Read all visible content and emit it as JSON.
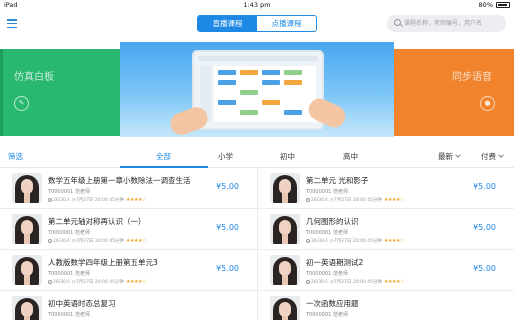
{
  "status_bar": {
    "device": "iPad",
    "time": "1:43 pm",
    "battery": "80%"
  },
  "header": {
    "tabs": [
      {
        "label": "直播课程",
        "active": true
      },
      {
        "label": "点播课程",
        "active": false
      }
    ],
    "search_placeholder": "课程名称，老师编号，用户名"
  },
  "banner": {
    "left_label": "仿真白板",
    "right_label": "同步语音",
    "left_icon": "pen-icon",
    "right_icon": "mic-icon",
    "dots": 4,
    "active_dot": 0
  },
  "filter": {
    "left": "筛选",
    "grades": [
      "全部",
      "小学",
      "初中",
      "高中"
    ],
    "active_grade": "全部",
    "sort": "最新",
    "price": "付费"
  },
  "courses": [
    {
      "title": "数学五年级上册第一章小数除法一调查生活",
      "teacher": "T0000001 范老师",
      "enrolled": "26/30人",
      "date": "7月27日 20:00",
      "duration": "45分钟",
      "stars": "★★★★☆",
      "price": "¥5.00"
    },
    {
      "title": "第二单元 光和影子",
      "teacher": "T0000001 范老师",
      "enrolled": "26/30人",
      "date": "7月27日 20:00",
      "duration": "45分钟",
      "stars": "★★★★☆",
      "price": "¥5.00"
    },
    {
      "title": "第二单元轴对称再认识（一）",
      "teacher": "T0000001 范老师",
      "enrolled": "26/30人",
      "date": "7月27日 20:00",
      "duration": "45分钟",
      "stars": "★★★★☆",
      "price": "¥5.00"
    },
    {
      "title": "几何图形的认识",
      "teacher": "T0000001 范老师",
      "enrolled": "26/30人",
      "date": "7月27日 20:00",
      "duration": "45分钟",
      "stars": "★★★★☆",
      "price": "¥5.00"
    },
    {
      "title": "人教版数学四年级上册第五单元3",
      "teacher": "T0000001 范老师",
      "enrolled": "26/30人",
      "date": "7月27日 20:00",
      "duration": "45分钟",
      "stars": "★★★★☆",
      "price": "¥5.00"
    },
    {
      "title": "初一英语期测试2",
      "teacher": "T0000001 范老师",
      "enrolled": "26/30人",
      "date": "7月27日 20:00",
      "duration": "45分钟",
      "stars": "★★★★☆",
      "price": "¥5.00"
    },
    {
      "title": "初中英语时态总复习",
      "teacher": "T0000001 范老师",
      "enrolled": "",
      "date": "",
      "duration": "",
      "stars": "",
      "price": ""
    },
    {
      "title": "一次函数应用题",
      "teacher": "T0000001 范老师",
      "enrolled": "",
      "date": "",
      "duration": "",
      "stars": "",
      "price": ""
    }
  ]
}
